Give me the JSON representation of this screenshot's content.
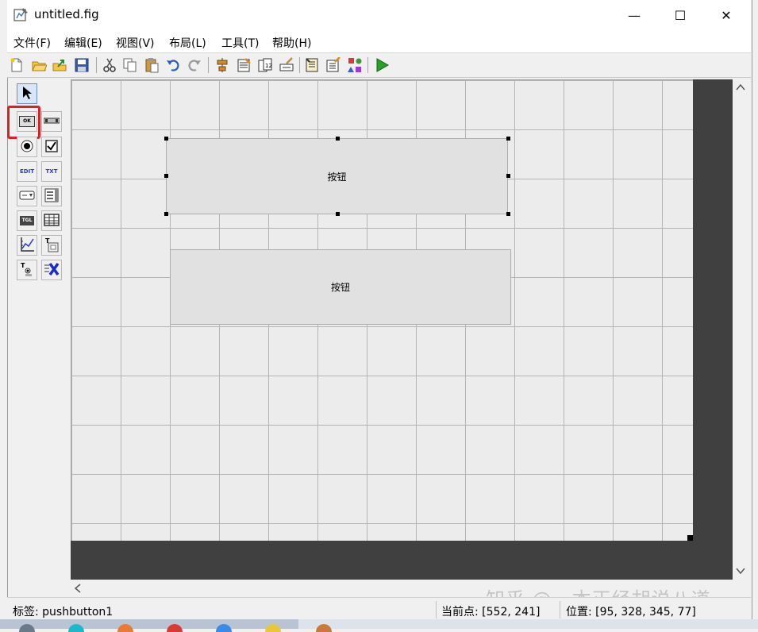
{
  "window": {
    "title": "untitled.fig",
    "minimize_glyph": "—",
    "maximize_glyph": "☐",
    "close_glyph": "✕"
  },
  "menubar": {
    "items": [
      {
        "label": "文件(F)"
      },
      {
        "label": "编辑(E)"
      },
      {
        "label": "视图(V)"
      },
      {
        "label": "布局(L)"
      },
      {
        "label": "工具(T)"
      },
      {
        "label": "帮助(H)"
      }
    ]
  },
  "toolbar": {
    "icons": [
      "new-file-icon",
      "open-folder-icon",
      "export-icon",
      "save-icon",
      "cut-icon",
      "copy-icon",
      "paste-icon",
      "undo-icon",
      "redo-icon",
      "align-objects-icon",
      "menu-editor-icon",
      "tab-order-editor-icon",
      "toolbar-editor-icon",
      "editor-icon",
      "property-inspector-icon",
      "object-browser-icon",
      "run-figure-icon"
    ]
  },
  "palette": {
    "items": [
      {
        "icon": "select-arrow-icon"
      },
      {
        "icon": "push-button-icon",
        "text": "OK"
      },
      {
        "icon": "slider-icon"
      },
      {
        "icon": "radio-button-icon"
      },
      {
        "icon": "checkbox-icon"
      },
      {
        "icon": "edit-text-icon",
        "text": "EDIT"
      },
      {
        "icon": "static-text-icon",
        "text": "TXT"
      },
      {
        "icon": "popup-menu-icon"
      },
      {
        "icon": "listbox-icon"
      },
      {
        "icon": "toggle-button-icon",
        "text": "TGL"
      },
      {
        "icon": "table-icon"
      },
      {
        "icon": "axes-icon"
      },
      {
        "icon": "panel-icon"
      },
      {
        "icon": "button-group-icon"
      },
      {
        "icon": "activex-control-icon"
      }
    ]
  },
  "canvas": {
    "buttons": [
      {
        "label": "按钮",
        "selected": true
      },
      {
        "label": "按钮",
        "selected": false
      }
    ]
  },
  "statusbar": {
    "tag": "标签: pushbutton1",
    "current_point": "当前点:  [552, 241]",
    "position": "位置: [95, 328, 345, 77]"
  },
  "watermark": "知乎 @一本正经胡说八道"
}
